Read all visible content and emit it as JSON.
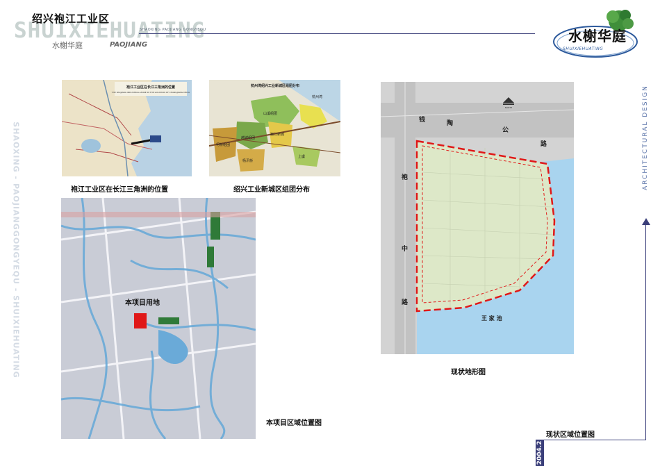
{
  "header": {
    "title": "绍兴袍江工业区",
    "brand_latin": "SHUIXIEHUATING",
    "brand_latin_small": "SHAOXING PAOJIANG GONGYEQU",
    "brand_cn": "水榭华庭",
    "brand_paojiang": "PAOJIANG"
  },
  "logo": {
    "text": "水榭华庭",
    "subtitle": "SHUIXIEHUATING"
  },
  "side": {
    "left_vertical": "SHAOXING - PAOJIANGGONGYEQU - SHUIXIEHUATING",
    "right_vertical": "ARCHITECTURAL DESIGN",
    "date": "2004.2"
  },
  "maps": {
    "map1": {
      "caption": "袍江工业区在长江三角洲的位置",
      "inner_title": "袍江工业区在长江三角洲的位置",
      "inner_subtitle": "THE PAOJIANG INDUSTRIAL ZONE IN THE LOCATION OF CHANGJIANG DELTA"
    },
    "map2": {
      "caption": "绍兴工业新城区组团分布",
      "inner_title": "杭州湾绍兴工业新城区组团分布",
      "labels": [
        "杭州湾",
        "山溪组团",
        "袍江新城",
        "越城组团",
        "柯桥组团",
        "杨汛桥",
        "上虞"
      ]
    },
    "map3": {
      "caption": "本项目区域位置图",
      "project_label": "本项目用地"
    },
    "map4": {
      "caption": "现状地形图",
      "road_north": [
        "钱",
        "陶",
        "公",
        "路"
      ],
      "road_west": [
        "袍",
        "中",
        "路"
      ],
      "lake_label": "王  家  池",
      "north_label": "NORTH"
    },
    "bottom_caption": "现状区域位置图"
  },
  "colors": {
    "accent_navy": "#3b3f7a",
    "site_red": "#e01818",
    "water_blue": "#a9d4ef",
    "site_green": "#dde8c8"
  }
}
